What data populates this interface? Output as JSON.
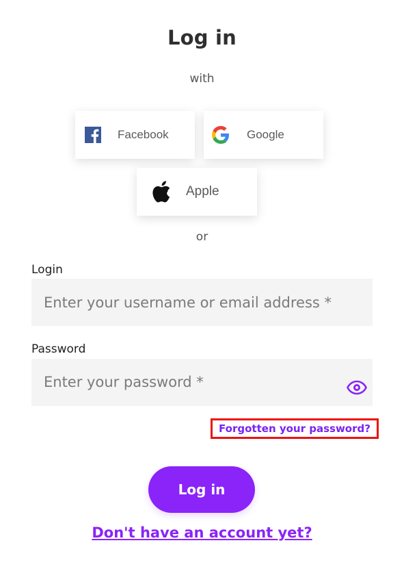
{
  "header": {
    "title": "Log in",
    "with_text": "with"
  },
  "social": {
    "facebook_label": "Facebook",
    "google_label": "Google",
    "apple_label": "Apple"
  },
  "divider": {
    "or_text": "or"
  },
  "form": {
    "login_label": "Login",
    "login_placeholder": "Enter your username or email address *",
    "login_value": "",
    "password_label": "Password",
    "password_placeholder": "Enter your password *",
    "password_value": "",
    "forgot_link": "Forgotten your password?",
    "submit_label": "Log in",
    "signup_link": "Don't have an account yet?"
  },
  "icons": {
    "facebook": "facebook-icon",
    "google": "google-icon",
    "apple": "apple-icon",
    "show_password": "eye-icon"
  },
  "colors": {
    "accent": "#8a24f8",
    "link": "#7a22f2",
    "highlight_border": "#ee1111",
    "input_bg": "#f4f4f4",
    "facebook_blue": "#3b5998"
  }
}
